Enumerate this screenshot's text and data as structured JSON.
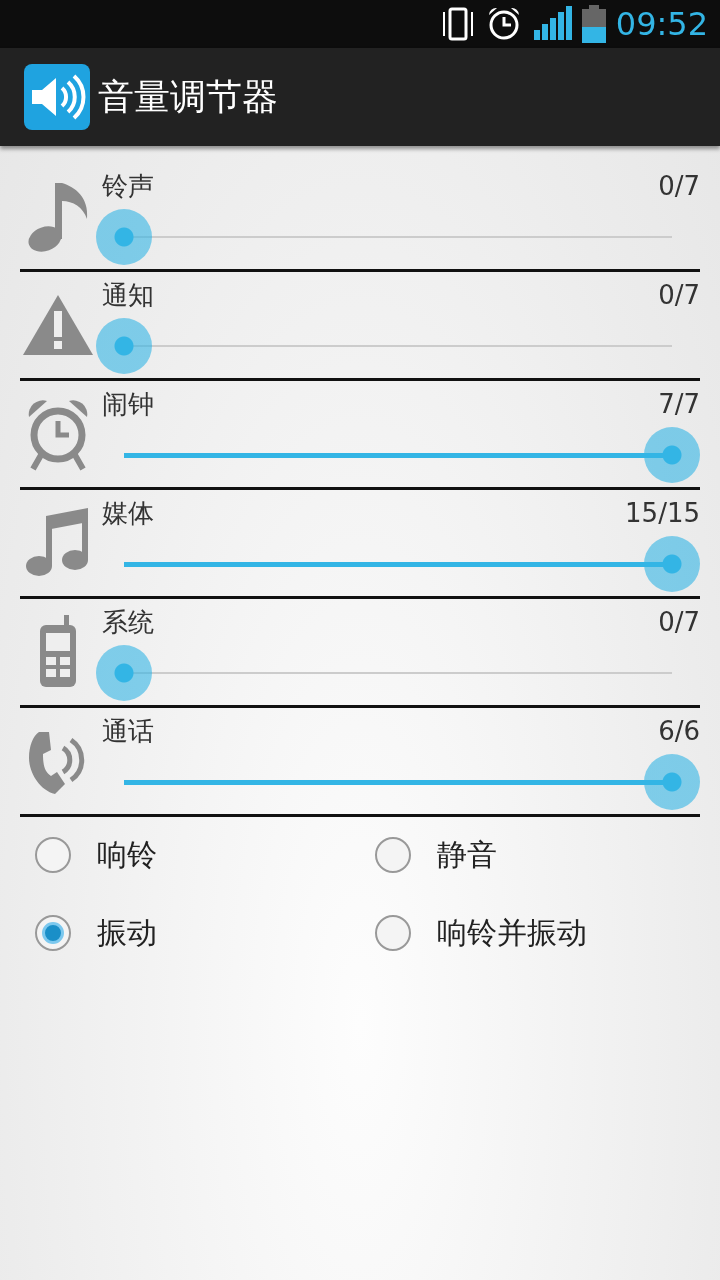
{
  "status_bar": {
    "time": "09:52"
  },
  "app_bar": {
    "title": "音量调节器"
  },
  "volumes": [
    {
      "label": "铃声",
      "reading": "0/7",
      "level": 0
    },
    {
      "label": "通知",
      "reading": "0/7",
      "level": 0
    },
    {
      "label": "闹钟",
      "reading": "7/7",
      "level": 1
    },
    {
      "label": "媒体",
      "reading": "15/15",
      "level": 1
    },
    {
      "label": "系统",
      "reading": "0/7",
      "level": 0
    },
    {
      "label": "通话",
      "reading": "6/6",
      "level": 1
    }
  ],
  "ring_modes": [
    {
      "label": "响铃",
      "selected": false
    },
    {
      "label": "静音",
      "selected": false
    },
    {
      "label": "振动",
      "selected": true
    },
    {
      "label": "响铃并振动",
      "selected": false
    }
  ]
}
